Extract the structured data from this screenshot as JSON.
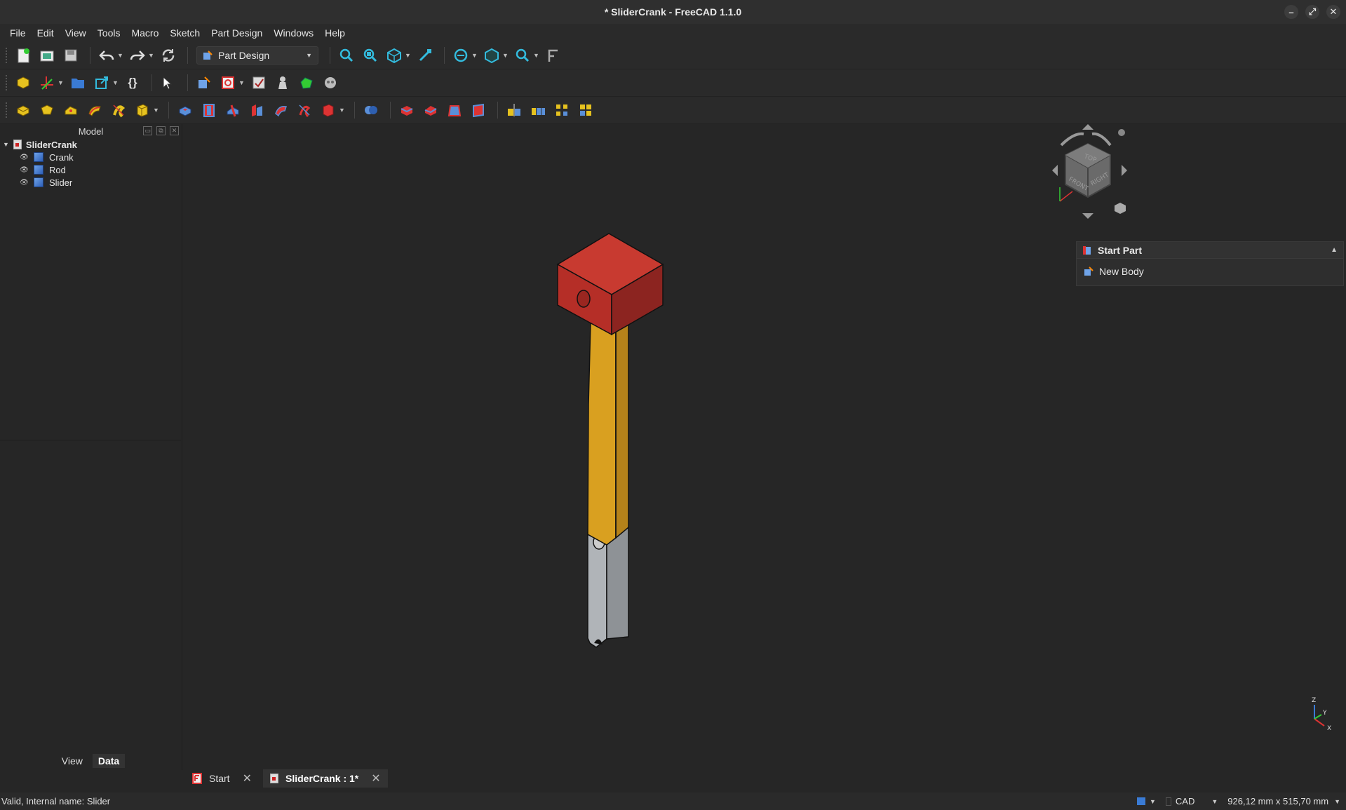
{
  "window": {
    "title": "* SliderCrank - FreeCAD 1.1.0"
  },
  "menu": [
    "File",
    "Edit",
    "View",
    "Tools",
    "Macro",
    "Sketch",
    "Part Design",
    "Windows",
    "Help"
  ],
  "workbench": {
    "selected": "Part Design"
  },
  "model_panel": {
    "title": "Model",
    "root": "SliderCrank",
    "items": [
      "Crank",
      "Rod",
      "Slider"
    ]
  },
  "panel_tabs": {
    "view": "View",
    "data": "Data"
  },
  "task_panel": {
    "title": "Start Part",
    "item": "New Body"
  },
  "doc_tabs": {
    "start": "Start",
    "current": "SliderCrank : 1*"
  },
  "status": {
    "message": "Valid, Internal name: Slider",
    "nav_style": "CAD",
    "dimensions": "926,12 mm x 515,70 mm"
  },
  "navcube": {
    "top": "TOP",
    "front": "FRONT",
    "right": "RIGHT"
  },
  "axes": {
    "x": "X",
    "y": "Y",
    "z": "Z"
  },
  "colors": {
    "crank": "#c0302a",
    "rod": "#d9a020",
    "slider": "#b0b4b8",
    "accent": "#3a7bd5"
  }
}
